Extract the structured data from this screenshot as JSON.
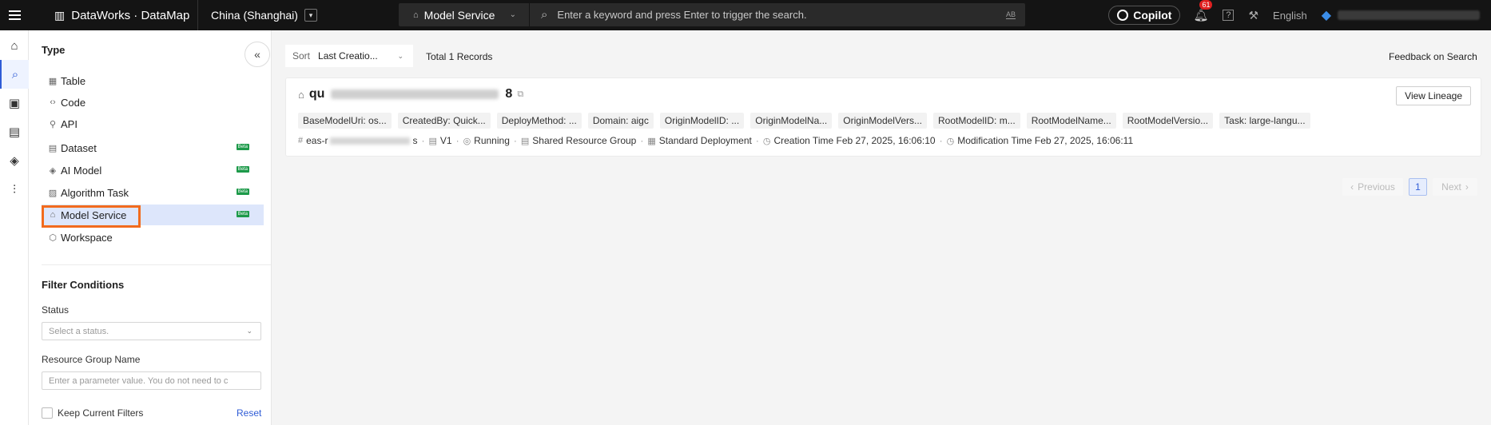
{
  "topbar": {
    "brand": "DataWorks · DataMap",
    "region": "China (Shanghai)",
    "search_scope": "Model Service",
    "search_placeholder": "Enter a keyword and press Enter to trigger the search.",
    "search_ab": "AB",
    "copilot": "Copilot",
    "notification_count": "61",
    "help": "?",
    "language": "English"
  },
  "sidebar": {
    "type_title": "Type",
    "items": [
      {
        "label": "Table",
        "icon": "table-icon",
        "beta": ""
      },
      {
        "label": "Code",
        "icon": "code-icon",
        "beta": ""
      },
      {
        "label": "API",
        "icon": "api-icon",
        "beta": ""
      },
      {
        "label": "Dataset",
        "icon": "dataset-icon",
        "beta": "Beta"
      },
      {
        "label": "AI Model",
        "icon": "cube-icon",
        "beta": "Beta"
      },
      {
        "label": "Algorithm Task",
        "icon": "chart-icon",
        "beta": "Beta"
      },
      {
        "label": "Model Service",
        "icon": "model-service-icon",
        "beta": "Beta"
      },
      {
        "label": "Workspace",
        "icon": "workspace-icon",
        "beta": ""
      }
    ],
    "filter_title": "Filter Conditions",
    "status_label": "Status",
    "status_placeholder": "Select a status.",
    "rg_label": "Resource Group Name",
    "rg_placeholder": "Enter a parameter value. You do not need to c",
    "keep_label": "Keep Current Filters",
    "reset": "Reset"
  },
  "toolbar": {
    "sort_label": "Sort",
    "sort_value": "Last Creatio...",
    "total": "Total 1 Records",
    "feedback": "Feedback on Search"
  },
  "result": {
    "title_prefix": "qu",
    "title_suffix": "8",
    "view_lineage": "View Lineage",
    "tags": [
      "BaseModelUri: os...",
      "CreatedBy: Quick...",
      "DeployMethod: ...",
      "Domain: aigc",
      "OriginModelID: ...",
      "OriginModelNa...",
      "OriginModelVers...",
      "RootModelID: m...",
      "RootModelName...",
      "RootModelVersio...",
      "Task: large-langu..."
    ],
    "meta": {
      "id_prefix": "eas-r",
      "id_suffix": "s",
      "version": "V1",
      "status": "Running",
      "resource_group": "Shared Resource Group",
      "deployment": "Standard Deployment",
      "created": "Creation Time Feb 27, 2025, 16:06:10",
      "modified": "Modification Time Feb 27, 2025, 16:06:11"
    }
  },
  "pagination": {
    "previous": "Previous",
    "page": "1",
    "next": "Next"
  }
}
